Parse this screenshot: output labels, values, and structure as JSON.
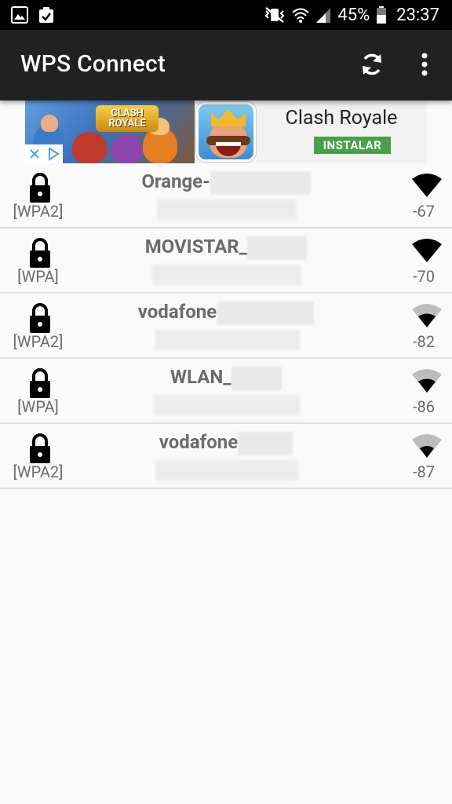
{
  "status_bar": {
    "battery": "45%",
    "time": "23:37"
  },
  "app_bar": {
    "title": "WPS Connect"
  },
  "ad": {
    "title": "Clash Royale",
    "install_label": "INSTALAR",
    "logo_text": "CLASH ROYALE"
  },
  "networks": [
    {
      "security": "[WPA2]",
      "ssid_visible": "Orange-",
      "signal": "-67"
    },
    {
      "security": "[WPA]",
      "ssid_visible": "MOVISTAR_",
      "signal": "-70"
    },
    {
      "security": "[WPA2]",
      "ssid_visible": "vodafone",
      "signal": "-82"
    },
    {
      "security": "[WPA]",
      "ssid_visible": "WLAN_",
      "signal": "-86"
    },
    {
      "security": "[WPA2]",
      "ssid_visible": "vodafone",
      "signal": "-87"
    }
  ],
  "colors": {
    "app_bar": "#212121",
    "status_bar": "#000000",
    "install_button": "#48a04a",
    "text_grey": "#6b6b6b"
  }
}
